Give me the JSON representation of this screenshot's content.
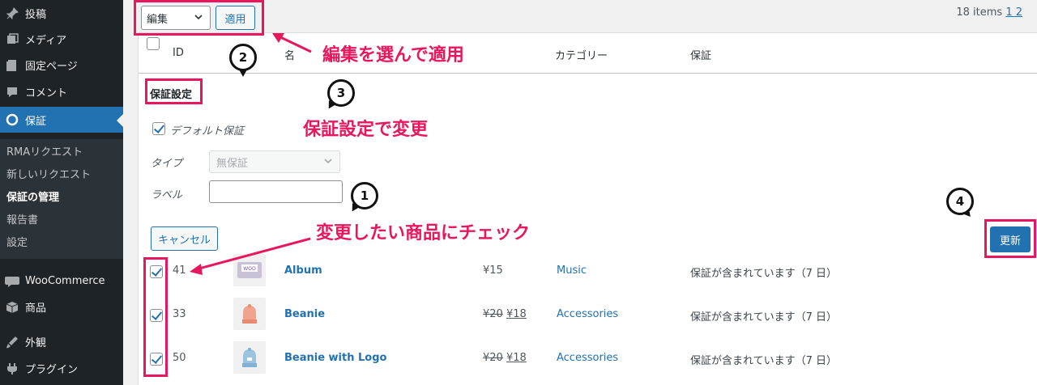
{
  "sidebar": {
    "items": [
      {
        "label": "投稿",
        "icon": "pin-icon"
      },
      {
        "label": "メディア",
        "icon": "media-icon"
      },
      {
        "label": "固定ページ",
        "icon": "page-icon"
      },
      {
        "label": "コメント",
        "icon": "comment-icon"
      },
      {
        "label": "保証",
        "icon": "warranty-icon"
      }
    ],
    "submenu": [
      "RMAリクエスト",
      "新しいリクエスト",
      "保証の管理",
      "報告書",
      "設定"
    ],
    "items_bottom": [
      {
        "label": "WooCommerce",
        "icon": "woocommerce-icon"
      },
      {
        "label": "商品",
        "icon": "products-icon"
      },
      {
        "label": "外観",
        "icon": "appearance-icon"
      },
      {
        "label": "プラグイン",
        "icon": "plugin-icon"
      }
    ]
  },
  "toolbar": {
    "bulk_action": "編集",
    "apply_label": "適用",
    "items_count": "18 items",
    "pages": "1 2"
  },
  "table": {
    "headers": {
      "id": "ID",
      "name": "名",
      "category": "カテゴリー",
      "warranty": "保証"
    }
  },
  "quick_edit": {
    "title": "保証設定",
    "default_warranty_label": "デフォルト保証",
    "type_label": "タイプ",
    "type_value": "無保証",
    "label_label": "ラベル",
    "cancel_label": "キャンセル",
    "update_label": "更新"
  },
  "rows": [
    {
      "id": "41",
      "name": "Album",
      "price": "¥15",
      "price_old": "",
      "category": "Music",
      "warranty": "保証が含まれています（7 日）",
      "thumb": "WOO"
    },
    {
      "id": "33",
      "name": "Beanie",
      "price": "¥18",
      "price_old": "¥20",
      "category": "Accessories",
      "warranty": "保証が含まれています（7 日）",
      "thumb": ""
    },
    {
      "id": "50",
      "name": "Beanie with Logo",
      "price": "¥18",
      "price_old": "¥20",
      "category": "Accessories",
      "warranty": "保証が含まれています（7 日）",
      "thumb": ""
    }
  ],
  "annotations": {
    "step1": "1",
    "step2": "2",
    "step3": "3",
    "step4": "4",
    "text1": "変更したい商品にチェック",
    "text2": "編集を選んで適用",
    "text3": "保証設定で変更"
  },
  "colors": {
    "accent": "#2271b1",
    "annotation": "#e8175d",
    "sidebar": "#1d2327"
  }
}
